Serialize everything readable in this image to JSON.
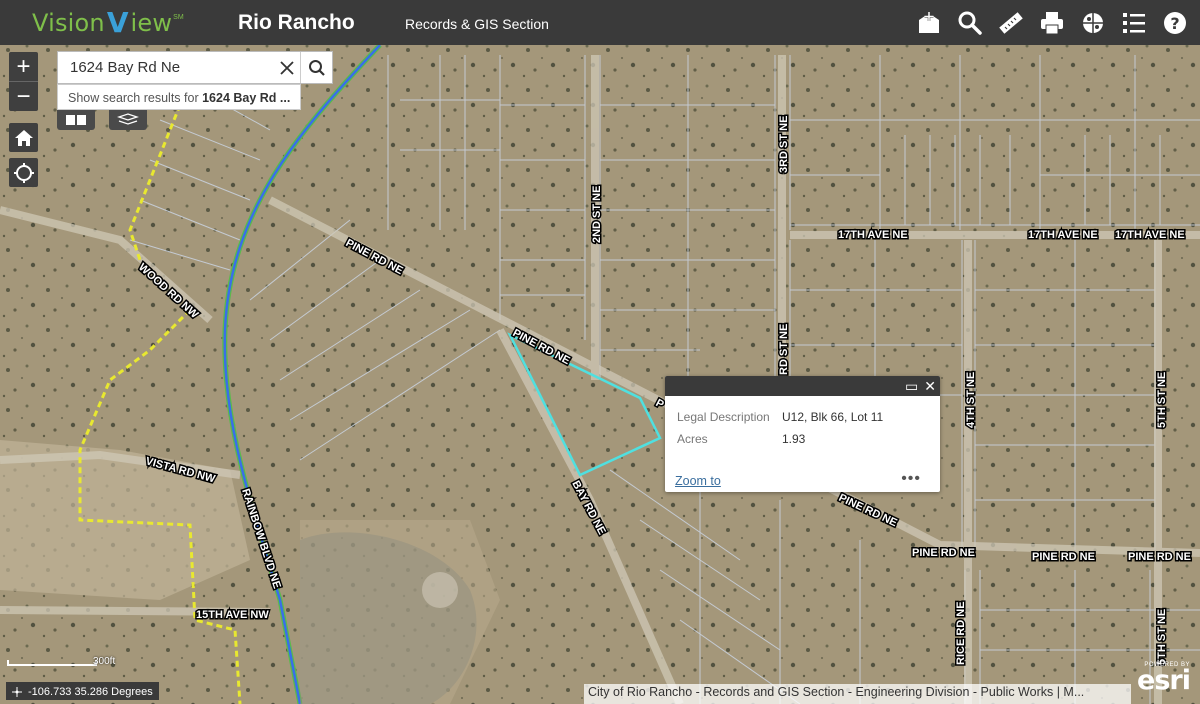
{
  "header": {
    "logo": "Vision",
    "logo_v": "V",
    "logo_suffix": "iew",
    "logo_sm": "SM",
    "city": "Rio Rancho",
    "section": "Records & GIS Section",
    "tools": [
      "add-data-icon",
      "search-tool-icon",
      "measure-icon",
      "print-icon",
      "basemap-icon",
      "layer-list-icon",
      "help-icon"
    ]
  },
  "search": {
    "value": "1624 Bay Rd Ne",
    "suggest_prefix": "Show search results for ",
    "suggest_term": "1624 Bay Rd ..."
  },
  "popup": {
    "fields": [
      {
        "label": "Legal Description",
        "value": "U12, Blk 66, Lot 11"
      },
      {
        "label": "Acres",
        "value": "1.93"
      }
    ],
    "zoom_link": "Zoom to",
    "more": "•••"
  },
  "map": {
    "roads": [
      "PINE RD NE",
      "PINE RD NE",
      "P",
      "PINE RD NE",
      "PINE RD NE",
      "PINE RD NE",
      "PINE RD NE",
      "17TH AVE NE",
      "17TH AVE NE",
      "17TH AVE NE",
      "2ND ST NE",
      "3RD ST NE",
      "RD ST NE",
      "4TH ST NE",
      "5TH ST NE",
      "5TH ST NE",
      "RICE RD NE",
      "WOOD RD NW",
      "VISTA RD NW",
      "RAINBOW BLVD NE",
      "BAY RD NE",
      "15TH AVE NW"
    ]
  },
  "scale_label": "300ft",
  "coordinates": "-106.733 35.286 Degrees",
  "attribution": "City of Rio Rancho - Records and GIS Section - Engineering Division - Public Works | M...",
  "esri": {
    "powered": "POWERED BY",
    "name": "esri"
  },
  "colors": {
    "header_bg": "#3a3a3a",
    "parcel_line": "#c8d0dc",
    "selected_parcel": "#4fe0e0",
    "boundary": "#e8e830",
    "rainbow_green": "#5aba4a",
    "rainbow_blue": "#3a6ee8"
  }
}
